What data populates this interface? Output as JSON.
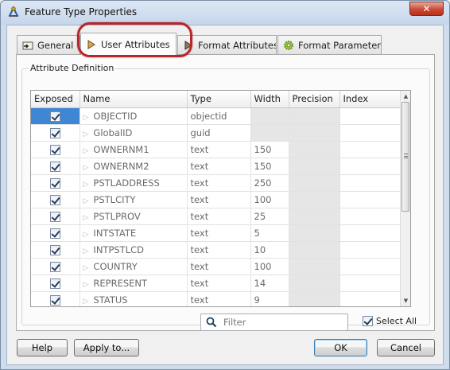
{
  "window": {
    "title": "Feature Type Properties",
    "close_glyph": "✕"
  },
  "tabs": [
    {
      "label": "General",
      "icon": "general-icon"
    },
    {
      "label": "User Attributes",
      "icon": "arrow-right-icon",
      "active": true
    },
    {
      "label": "Format Attributes",
      "icon": "format-attributes-icon"
    },
    {
      "label": "Format Parameters",
      "icon": "gear-icon"
    }
  ],
  "group": {
    "label": "Attribute Definition"
  },
  "grid": {
    "headers": [
      "Exposed",
      "Name",
      "Type",
      "Width",
      "Precision",
      "Index"
    ],
    "rows": [
      {
        "name": "OBJECTID",
        "type": "objectid",
        "width": ""
      },
      {
        "name": "GlobalID",
        "type": "guid",
        "width": ""
      },
      {
        "name": "OWNERNM1",
        "type": "text",
        "width": "150"
      },
      {
        "name": "OWNERNM2",
        "type": "text",
        "width": "150"
      },
      {
        "name": "PSTLADDRESS",
        "type": "text",
        "width": "250"
      },
      {
        "name": "PSTLCITY",
        "type": "text",
        "width": "100"
      },
      {
        "name": "PSTLPROV",
        "type": "text",
        "width": "25"
      },
      {
        "name": "INTSTATE",
        "type": "text",
        "width": "5"
      },
      {
        "name": "INTPSTLCD",
        "type": "text",
        "width": "10"
      },
      {
        "name": "COUNTRY",
        "type": "text",
        "width": "100"
      },
      {
        "name": "REPRESENT",
        "type": "text",
        "width": "14"
      },
      {
        "name": "STATUS",
        "type": "text",
        "width": "9"
      }
    ]
  },
  "filter": {
    "placeholder": "Filter"
  },
  "select_all": {
    "label": "Select All"
  },
  "buttons": {
    "help": "Help",
    "apply": "Apply to...",
    "ok": "OK",
    "cancel": "Cancel"
  },
  "colors": {
    "selection": "#3f86d4",
    "highlight_ring": "#b7262b"
  }
}
